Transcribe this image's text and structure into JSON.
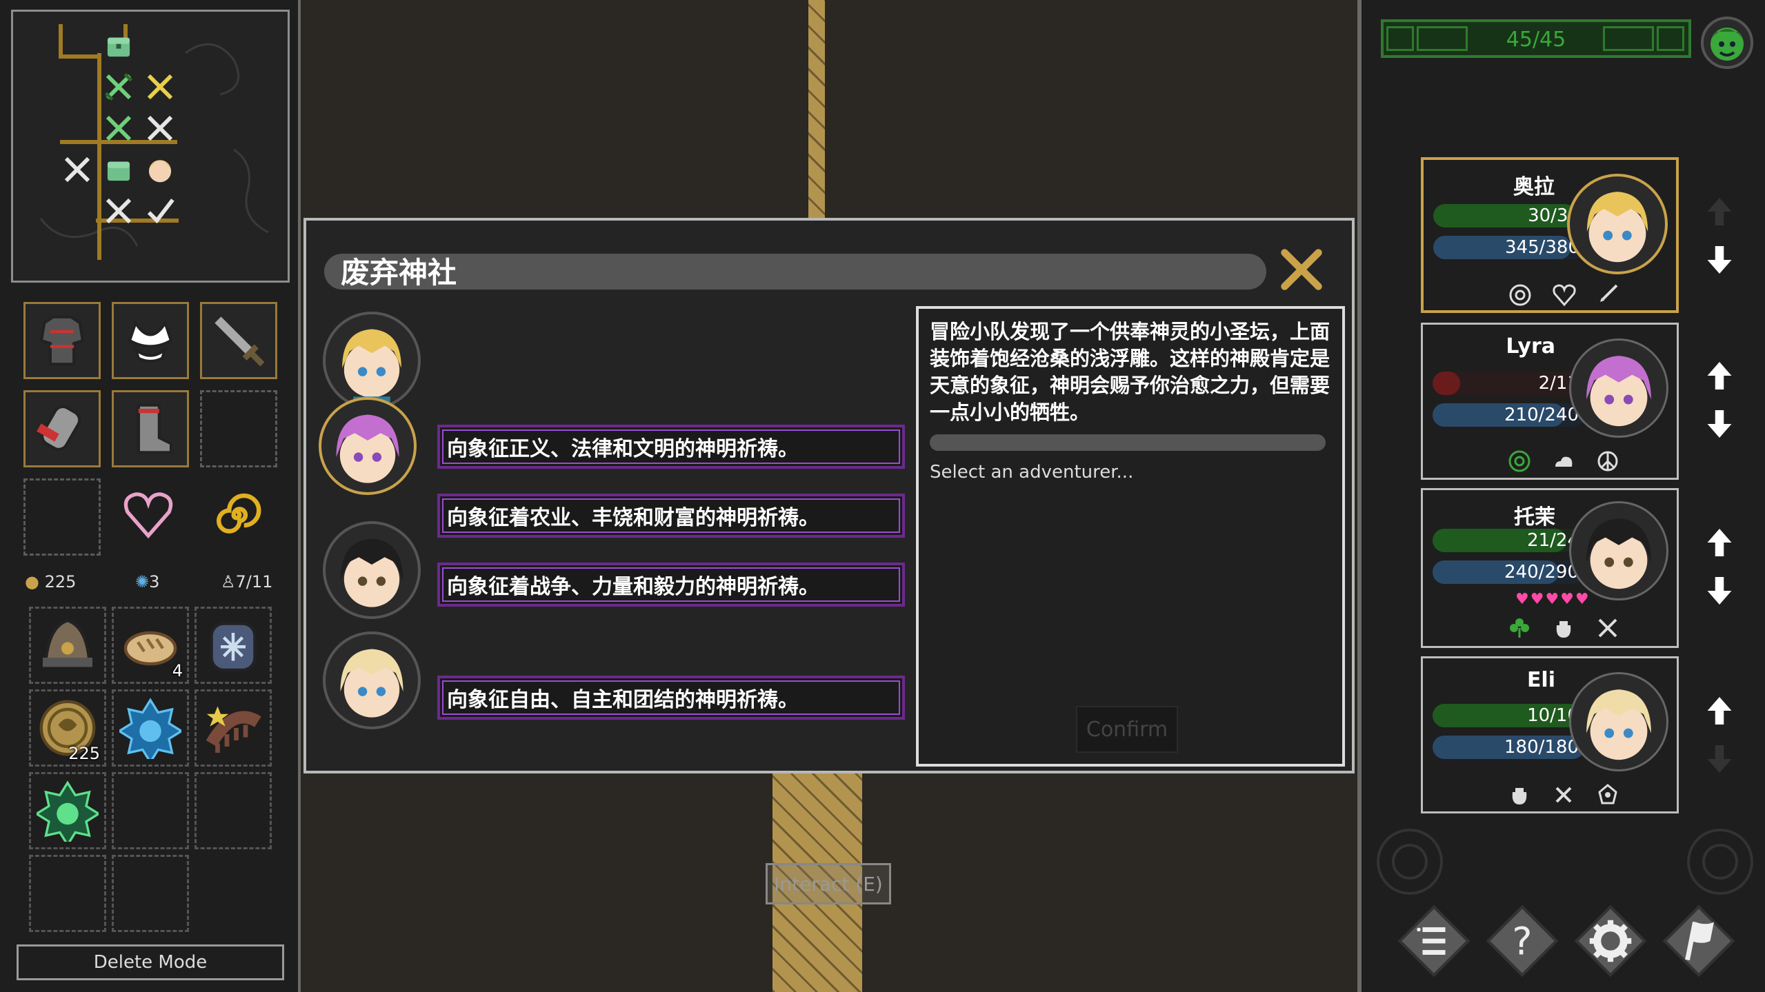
{
  "inventory": {
    "gold": "225",
    "gems": "3",
    "capacity": "7/11",
    "items": [
      {
        "icon": "helmet-icon"
      },
      {
        "icon": "bread-icon",
        "count": "4"
      },
      {
        "icon": "snowflake-potion-icon"
      },
      {
        "icon": "gold-coin-icon",
        "count": "225"
      },
      {
        "icon": "blue-gem-icon"
      },
      {
        "icon": "star-comb-icon"
      },
      {
        "icon": "green-gem-icon"
      }
    ],
    "delete_mode_label": "Delete Mode"
  },
  "event": {
    "title": "废弃神社",
    "options": [
      "向象征正义、法律和文明的神明祈祷。",
      "向象征着农业、丰饶和财富的神明祈祷。",
      "向象征着战争、力量和毅力的神明祈祷。",
      "向象征自由、自主和团结的神明祈祷。"
    ],
    "description": "冒险小队发现了一个供奉神灵的小圣坛，上面装饰着饱经沧桑的浅浮雕。这样的神殿肯定是天意的象征，神明会赐予你治愈之力，但需要一点小小的牺牲。",
    "prompt": "Select an adventurer...",
    "confirm_label": "Confirm"
  },
  "interact_label": "Interact (E)",
  "party_hp": "45/45",
  "party": [
    {
      "name": "奥拉",
      "hp": "30/32",
      "hp_frac": 0.94,
      "xp": "345/380",
      "xp_frac": 0.91,
      "hp_color": "#1f5a1f",
      "hair": "#e8c45a"
    },
    {
      "name": "Lyra",
      "hp": "2/11",
      "hp_frac": 0.18,
      "xp": "210/240",
      "xp_frac": 0.87,
      "hp_color": "#6a1c1c",
      "hair": "#c36fd0"
    },
    {
      "name": "托茉",
      "hp": "21/24",
      "hp_frac": 0.88,
      "xp": "240/290",
      "xp_frac": 0.83,
      "hp_color": "#1f5a1f",
      "hair": "#1e1e1e",
      "hearts": "♥♥♥♥♥"
    },
    {
      "name": "Eli",
      "hp": "10/10",
      "hp_frac": 1.0,
      "xp": "180/180",
      "xp_frac": 1.0,
      "hp_color": "#1f5a1f",
      "hair": "#efdca8"
    }
  ],
  "colors": {
    "accent_gold": "#c9a24a",
    "option_border": "#6b2a8c",
    "hp_green": "#2e7a2e"
  }
}
